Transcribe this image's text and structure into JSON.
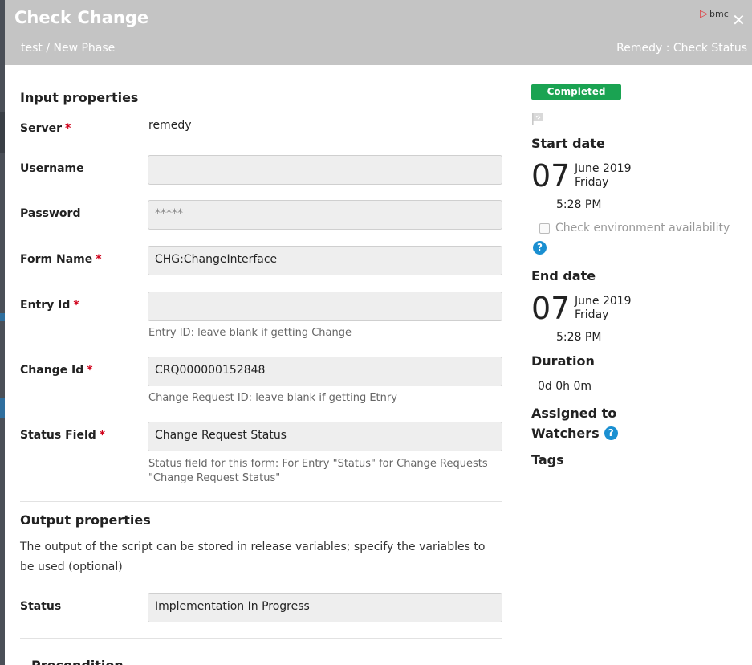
{
  "modal": {
    "title": "Check Change",
    "breadcrumb": "test / New Phase",
    "plugin_label": "Remedy : Check Status",
    "logo_text": "bmc",
    "close_glyph": "✕"
  },
  "input": {
    "section_title": "Input properties",
    "server": {
      "label": "Server",
      "value": "remedy"
    },
    "username": {
      "label": "Username",
      "value": ""
    },
    "password": {
      "label": "Password",
      "value": "*****"
    },
    "form_name": {
      "label": "Form Name",
      "value": "CHG:ChangeInterface"
    },
    "entry_id": {
      "label": "Entry Id",
      "value": "",
      "hint": "Entry ID: leave blank if getting Change"
    },
    "change_id": {
      "label": "Change Id",
      "value": "CRQ000000152848",
      "hint": "Change Request ID: leave blank if getting Etnry"
    },
    "status_field": {
      "label": "Status Field",
      "value": "Change Request Status",
      "hint": "Status field for this form: For Entry \"Status\" for Change Requests \"Change Request Status\""
    },
    "required_mark": "*"
  },
  "output": {
    "section_title": "Output properties",
    "description": "The output of the script can be stored in release variables; specify the variables to be used (optional)",
    "status": {
      "label": "Status",
      "value": "Implementation In Progress"
    }
  },
  "precondition": {
    "label": "Precondition"
  },
  "sidebar": {
    "status_badge": "Completed",
    "start_date": {
      "label": "Start date",
      "day": "07",
      "month_year": "June 2019",
      "weekday": "Friday",
      "time": "5:28 PM"
    },
    "check_env": {
      "label": "Check environment availability",
      "checked": false
    },
    "help_glyph": "?",
    "end_date": {
      "label": "End date",
      "day": "07",
      "month_year": "June 2019",
      "weekday": "Friday",
      "time": "5:28 PM"
    },
    "duration": {
      "label": "Duration",
      "value": "0d 0h 0m"
    },
    "assigned_to": {
      "label": "Assigned to"
    },
    "watchers": {
      "label": "Watchers"
    },
    "tags": {
      "label": "Tags"
    }
  },
  "colors": {
    "header_bg": "#c4c4c4",
    "badge_green": "#1aa352",
    "required_red": "#d0021b",
    "help_blue": "#1a8fd1"
  }
}
